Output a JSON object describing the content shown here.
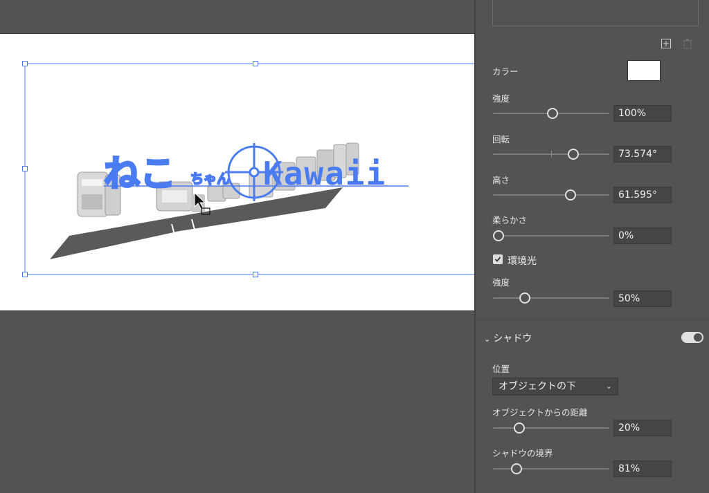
{
  "artwork": {
    "text_main": "ねこ",
    "text_small": "ちゃん",
    "text_latin": "Kawaii",
    "accent_color": "#4a7bf0"
  },
  "panel": {
    "color_label": "カラー",
    "color_value": "#ffffff",
    "intensity_label": "強度",
    "intensity_value": "100%",
    "intensity_level": 0.5,
    "rotation_label": "回転",
    "rotation_value": "73.574°",
    "height_label": "高さ",
    "height_value": "61.595°",
    "softness_label": "柔らかさ",
    "softness_value": "0%",
    "ambient_label": "環境光",
    "ambient_checked": true,
    "ambient_intensity_label": "強度",
    "ambient_intensity_value": "50%",
    "shadow_section": "シャドウ",
    "shadow_enabled": true,
    "position_label": "位置",
    "position_value": "オブジェクトの下",
    "distance_label": "オブジェクトからの距離",
    "distance_value": "20%",
    "boundary_label": "シャドウの境界",
    "boundary_value": "81%"
  }
}
